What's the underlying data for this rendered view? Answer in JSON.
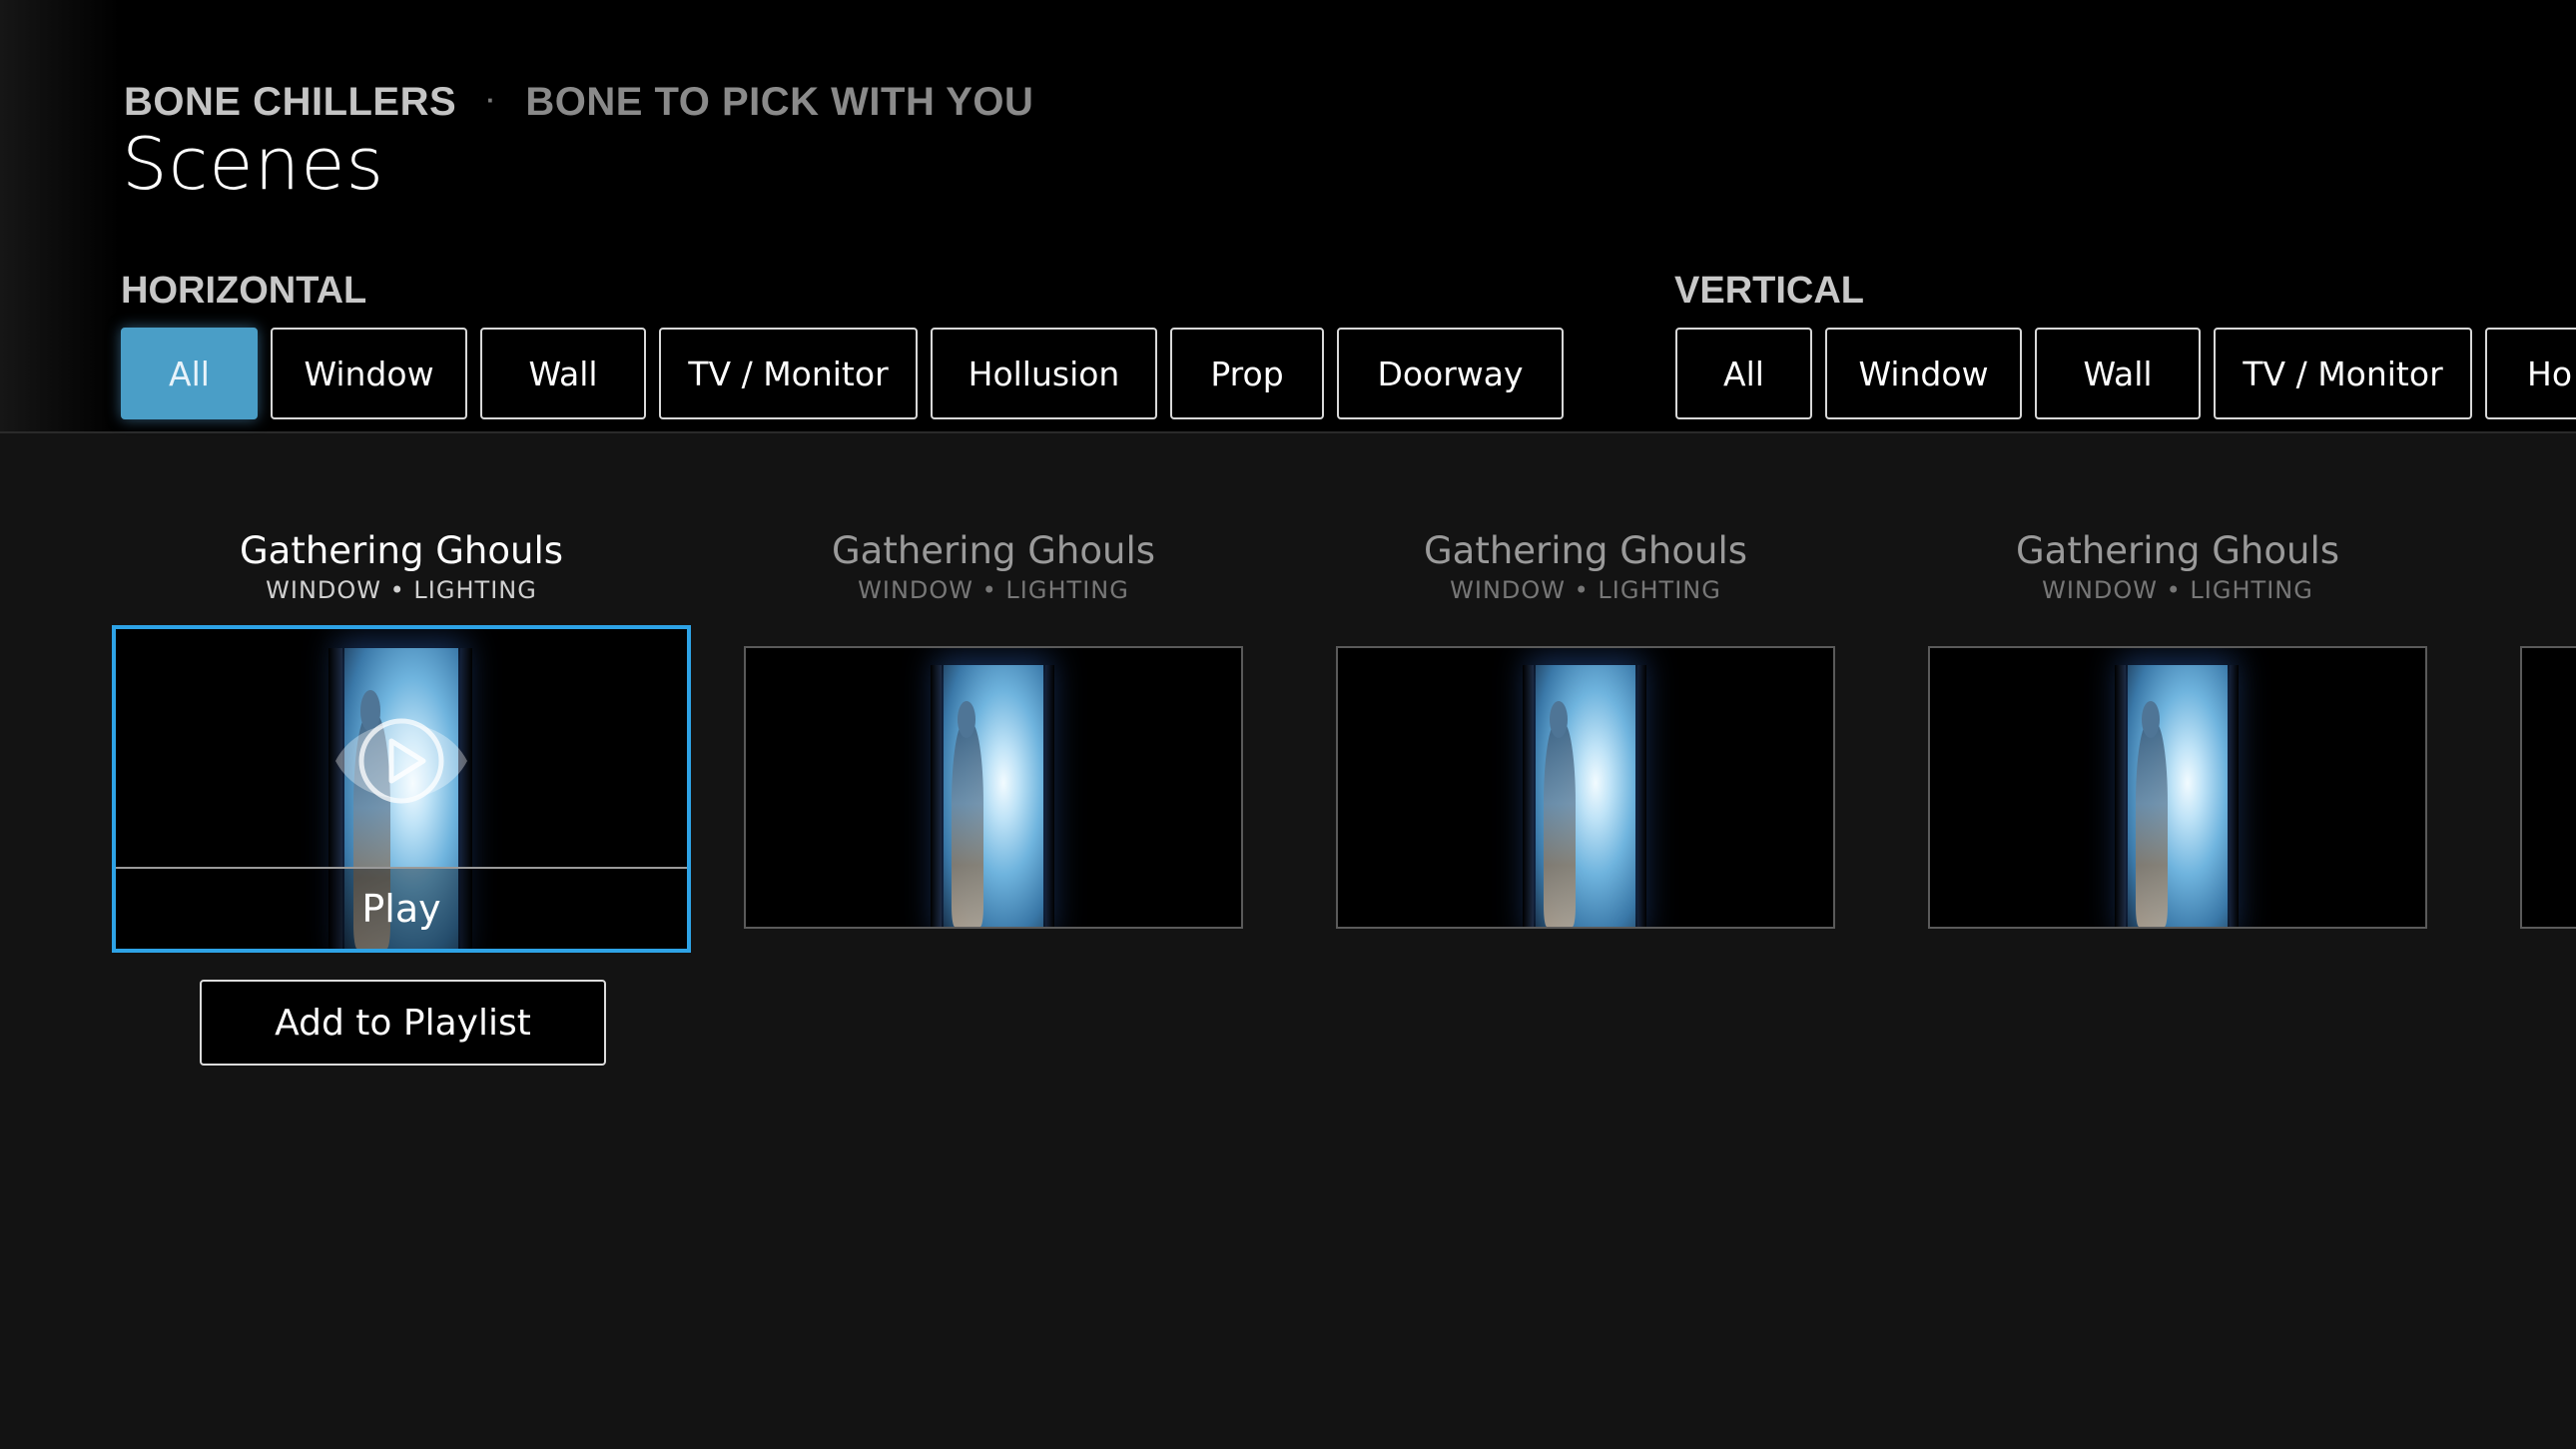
{
  "breadcrumb": {
    "show": "BONE CHILLERS",
    "separator": "·",
    "episode": "BONE TO PICK WITH YOU"
  },
  "page_title": "Scenes",
  "horizontal": {
    "label": "HORIZONTAL",
    "filters": [
      "All",
      "Window",
      "Wall",
      "TV / Monitor",
      "Hollusion",
      "Prop",
      "Doorway"
    ],
    "selected": "All"
  },
  "vertical": {
    "label": "VERTICAL",
    "filters": [
      "All",
      "Window",
      "Wall",
      "TV / Monitor",
      "Ho"
    ]
  },
  "scenes": [
    {
      "title": "Gathering Ghouls",
      "subtitle": "WINDOW • LIGHTING",
      "focused": true
    },
    {
      "title": "Gathering Ghouls",
      "subtitle": "WINDOW • LIGHTING",
      "focused": false
    },
    {
      "title": "Gathering Ghouls",
      "subtitle": "WINDOW • LIGHTING",
      "focused": false
    },
    {
      "title": "Gathering Ghouls",
      "subtitle": "WINDOW • LIGHTING",
      "focused": false
    }
  ],
  "focused_actions": {
    "play_label": "Play",
    "add_to_playlist_label": "Add to Playlist"
  },
  "icons": {
    "play": "play-circle-icon"
  },
  "colors": {
    "accent": "#2ea3e6",
    "active_filter": "#4a9ec7",
    "header_bg": "#000000",
    "body_bg": "#131313"
  }
}
